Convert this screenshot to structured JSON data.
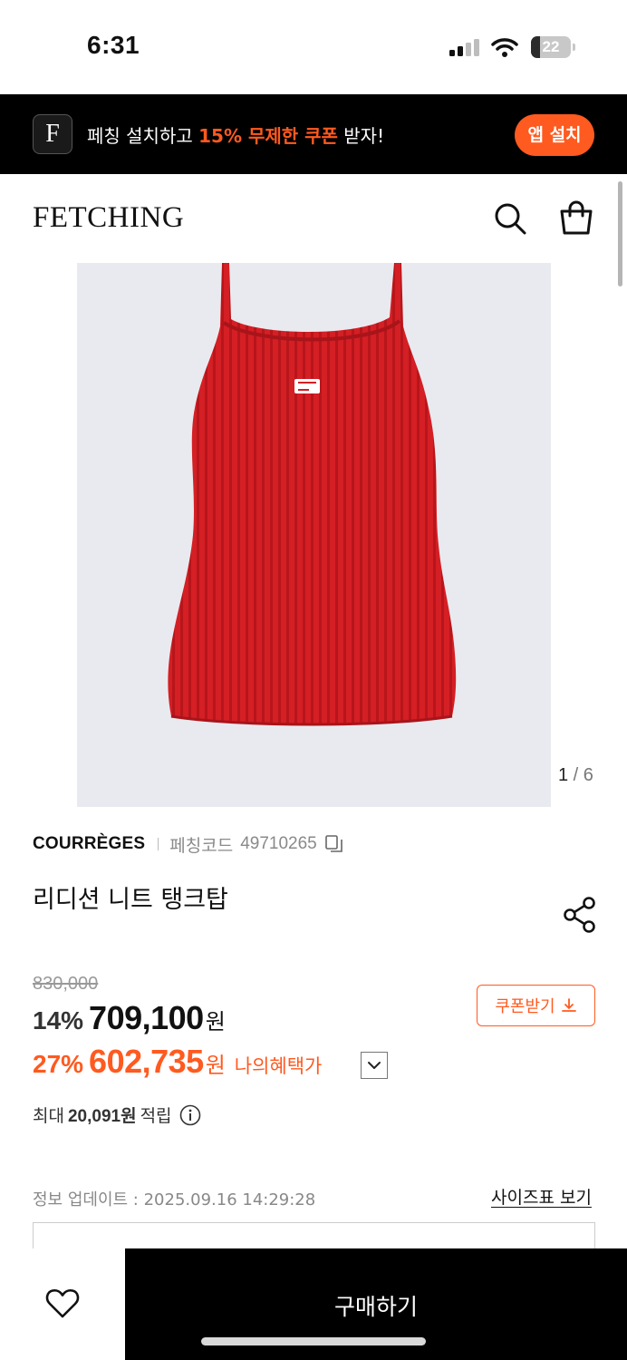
{
  "status_bar": {
    "time": "6:31",
    "battery": "22",
    "battery_level_percent": 22
  },
  "promo_banner": {
    "logo_letter": "F",
    "text_before": "페칭 설치하고 ",
    "text_highlight": "15% 무제한 쿠폰",
    "text_after": " 받자!",
    "install_label": "앱 설치",
    "accent_color": "#ff5a1f"
  },
  "header": {
    "logo": "FETCHING",
    "icons": [
      "search-icon",
      "shopping-bag-icon"
    ]
  },
  "gallery": {
    "current": "1",
    "separator": " / ",
    "total": "6"
  },
  "product": {
    "brand": "COURRÈGES",
    "code_label": "페칭코드",
    "code": "49710265",
    "title": "리디션 니트 탱크탑",
    "original_price": "830,000",
    "discount_rate": "14%",
    "price": "709,100",
    "currency": "원",
    "benefit_discount_rate": "27%",
    "benefit_price": "602,735",
    "benefit_label": "나의혜택가",
    "coupon_button": "쿠폰받기",
    "points_prefix": "최대",
    "points_value": "20,091원",
    "points_suffix": "적립",
    "update_info": "정보 업데이트 : 2025.09.16 14:29:28",
    "size_chart_link": "사이즈표 보기"
  },
  "bottom_bar": {
    "buy_label": "구매하기"
  }
}
